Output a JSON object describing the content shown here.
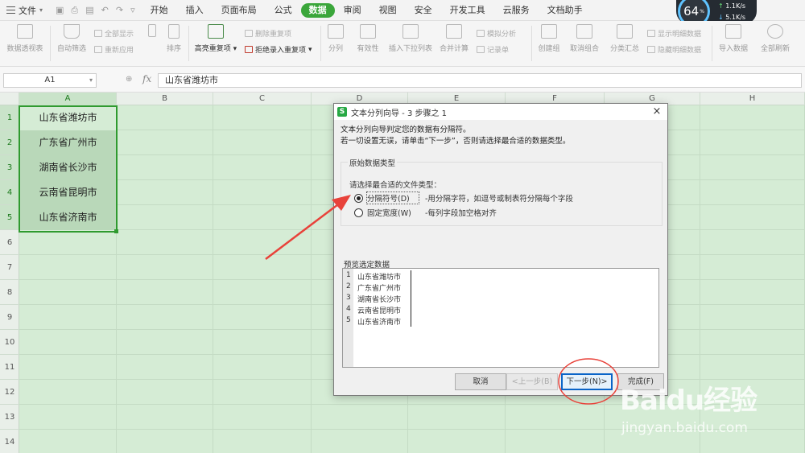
{
  "menubar": {
    "file_label": "文件",
    "tabs": [
      {
        "label": "开始",
        "active": false
      },
      {
        "label": "插入",
        "active": false
      },
      {
        "label": "页面布局",
        "active": false
      },
      {
        "label": "公式",
        "active": false
      },
      {
        "label": "数据",
        "active": true
      },
      {
        "label": "审阅",
        "active": false
      },
      {
        "label": "视图",
        "active": false
      },
      {
        "label": "安全",
        "active": false
      },
      {
        "label": "开发工具",
        "active": false
      },
      {
        "label": "云服务",
        "active": false
      },
      {
        "label": "文档助手",
        "active": false
      }
    ]
  },
  "speed_widget": {
    "percent": "64",
    "percent_unit": "%",
    "upload": "1.1K/s",
    "download": "5.1K/s"
  },
  "ribbon": {
    "pivot": "数据透视表",
    "autofilter": "自动筛选",
    "show_all": "全部显示",
    "reapply": "重新应用",
    "sort": "排序",
    "highlight_dup": "高亮重复项",
    "delete_dup": "删除重复项",
    "reject_dup": "拒绝录入重复项",
    "split": "分列",
    "validity": "有效性",
    "dropdown": "插入下拉列表",
    "consolidate": "合并计算",
    "simulate": "模拟分析",
    "record": "记录单",
    "group": "创建组",
    "ungroup": "取消组合",
    "subtotal": "分类汇总",
    "show_detail": "显示明细数据",
    "hide_detail": "隐藏明细数据",
    "import": "导入数据",
    "refresh_all": "全部刷新"
  },
  "formula_bar": {
    "cell_ref": "A1",
    "fx": "fx",
    "content": "山东省潍坊市"
  },
  "sheet": {
    "columns": [
      "A",
      "B",
      "C",
      "D",
      "E",
      "F",
      "G",
      "H"
    ],
    "rows": [
      "1",
      "2",
      "3",
      "4",
      "5",
      "6",
      "7",
      "8",
      "9",
      "10",
      "11",
      "12",
      "13",
      "14"
    ],
    "cells": [
      "山东省潍坊市",
      "广东省广州市",
      "湖南省长沙市",
      "云南省昆明市",
      "山东省济南市"
    ]
  },
  "dialog": {
    "title": "文本分列向导 - 3 步骤之 1",
    "close": "×",
    "desc_line1": "文本分列向导判定您的数据有分隔符。",
    "desc_line2": "若一切设置无误，请单击“下一步”，否则请选择最合适的数据类型。",
    "group_title": "原始数据类型",
    "group_prompt": "请选择最合适的文件类型：",
    "option1_label": "分隔符号(D)",
    "option1_desc": "-用分隔字符，如逗号或制表符分隔每个字段",
    "option1_checked": true,
    "option2_label": "固定宽度(W)",
    "option2_desc": "-每列字段加空格对齐",
    "option2_checked": false,
    "preview_title": "预览选定数据",
    "preview_lines": [
      {
        "n": "1",
        "text": "山东省潍坊市"
      },
      {
        "n": "2",
        "text": "广东省广州市"
      },
      {
        "n": "3",
        "text": "湖南省长沙市"
      },
      {
        "n": "4",
        "text": "云南省昆明市"
      },
      {
        "n": "5",
        "text": "山东省济南市"
      }
    ],
    "btn_cancel": "取消",
    "btn_back": "<上一步(B)",
    "btn_next": "下一步(N)>",
    "btn_finish": "完成(F)"
  },
  "annotation_color": "#e8423a",
  "watermark": {
    "main": "Baidu经验",
    "url": "jingyan.baidu.com"
  }
}
